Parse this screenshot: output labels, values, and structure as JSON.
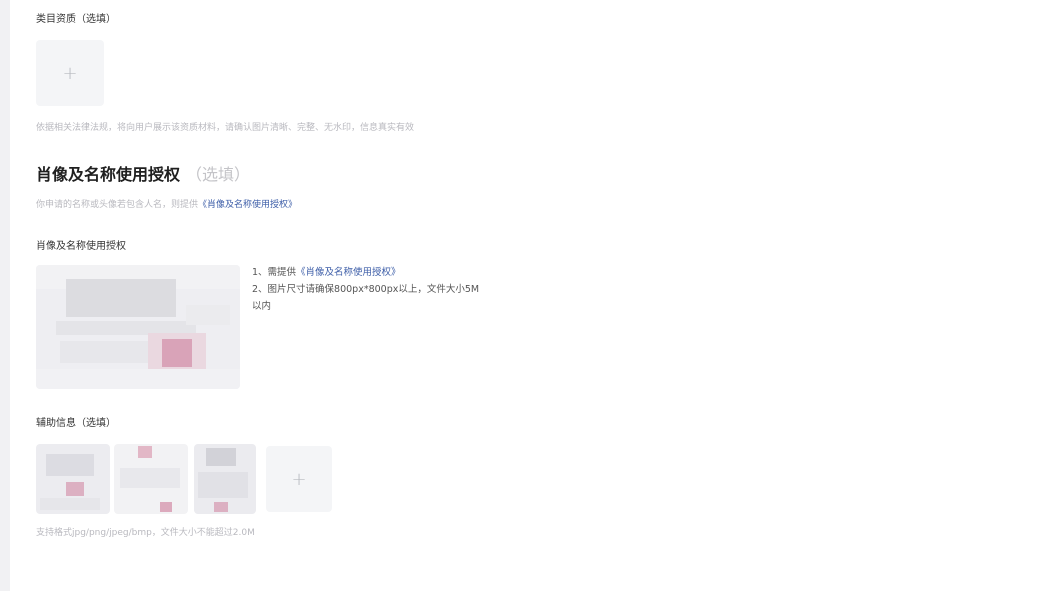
{
  "category_qualification": {
    "label": "类目资质（选填）",
    "add_icon": "plus-icon",
    "hint": "依据相关法律法规，将向用户展示该资质材料，请确认图片清晰、完整、无水印，信息真实有效"
  },
  "portrait_section": {
    "title": "肖像及名称使用授权",
    "optional": "（选填）",
    "hint_prefix": "你申请的名称或头像若包含人名，则提供",
    "hint_link": "《肖像及名称使用授权》",
    "field_label": "肖像及名称使用授权",
    "notes": {
      "line1_prefix": "1、需提供",
      "line1_link": "《肖像及名称使用授权》",
      "line2": "2、图片尺寸请确保800px*800px以上，文件大小5M",
      "line3": "以内"
    }
  },
  "auxiliary_info": {
    "label": "辅助信息（选填）",
    "add_icon": "plus-icon",
    "hint": "支持格式jpg/png/jpeg/bmp，文件大小不能超过2.0M"
  },
  "colors": {
    "link": "#3d5ea8",
    "hint": "#b9b9bf",
    "upload_bg": "#f4f5f7"
  }
}
